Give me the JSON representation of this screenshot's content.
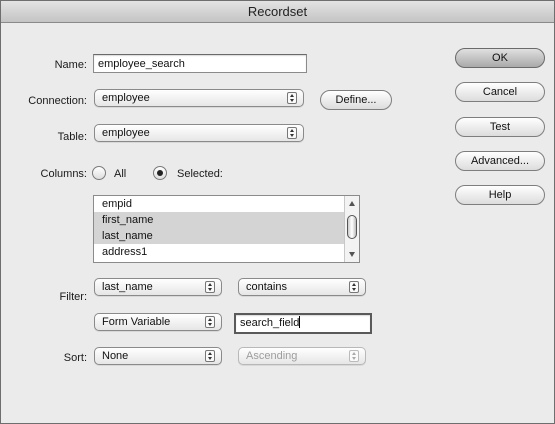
{
  "window": {
    "title": "Recordset"
  },
  "form": {
    "name_label": "Name:",
    "name_value": "employee_search",
    "connection_label": "Connection:",
    "connection_value": "employee",
    "define_label": "Define...",
    "table_label": "Table:",
    "table_value": "employee",
    "columns_label": "Columns:",
    "columns_all": "All",
    "columns_selected": "Selected:",
    "columns_mode": "Selected",
    "columns": [
      {
        "name": "empid",
        "selected": false
      },
      {
        "name": "first_name",
        "selected": true
      },
      {
        "name": "last_name",
        "selected": true
      },
      {
        "name": "address1",
        "selected": false
      }
    ],
    "filter_label": "Filter:",
    "filter_column": "last_name",
    "filter_operator": "contains",
    "filter_source": "Form Variable",
    "filter_value": "search_field",
    "sort_label": "Sort:",
    "sort_column": "None",
    "sort_order": "Ascending",
    "sort_order_enabled": false
  },
  "buttons": {
    "ok": "OK",
    "cancel": "Cancel",
    "test": "Test",
    "advanced": "Advanced...",
    "help": "Help"
  }
}
